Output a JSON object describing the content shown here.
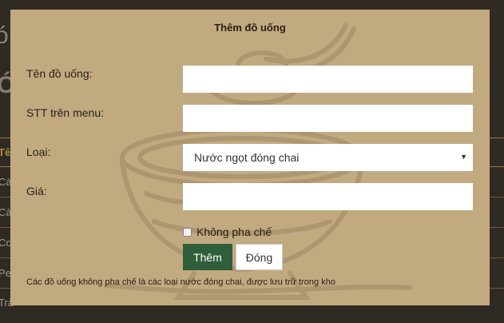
{
  "background": {
    "big_1": "ó",
    "big_2": "Ó",
    "rows": [
      "Tê",
      "Cà",
      "Cà",
      "Co",
      "Pe",
      "Trà"
    ]
  },
  "modal": {
    "title": "Thêm đồ uống",
    "fields": {
      "name_label": "Tên đồ uống:",
      "name_value": "",
      "order_label": "STT trên menu:",
      "order_value": "",
      "type_label": "Loại:",
      "type_selected": "Nước ngọt đóng chai",
      "price_label": "Giá:",
      "price_value": ""
    },
    "checkbox": {
      "label": "Không pha chế",
      "checked": false
    },
    "buttons": {
      "add": "Thêm",
      "close": "Đóng"
    },
    "note": "Các đồ uống không pha chế là các loại nước đóng chai, được lưu trữ trong kho"
  },
  "colors": {
    "modal_bg": "#c1aa80",
    "primary_button": "#2e5e3a",
    "backdrop": "#2f2a23"
  }
}
